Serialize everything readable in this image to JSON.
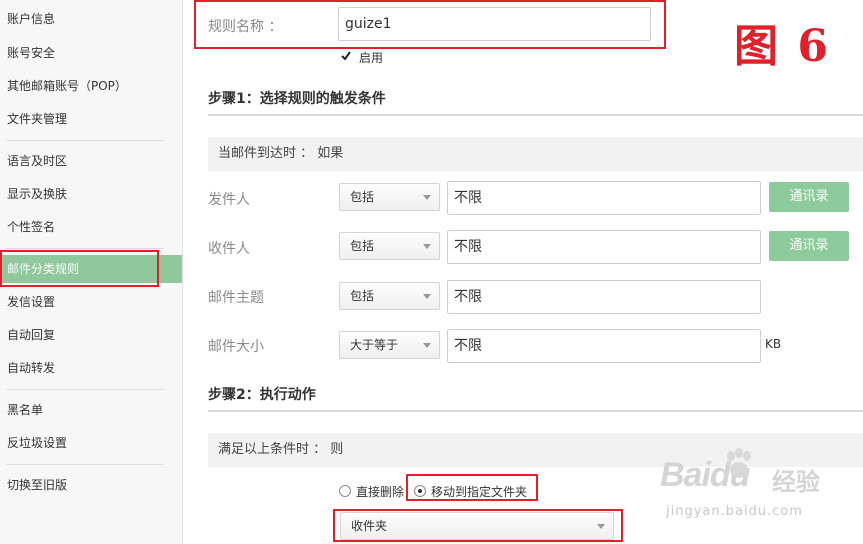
{
  "sidebar": {
    "items": [
      {
        "label": "账户信息"
      },
      {
        "label": "账号安全"
      },
      {
        "label": "其他邮箱账号（POP）"
      },
      {
        "label": "文件夹管理"
      },
      {
        "label": "语言及时区"
      },
      {
        "label": "显示及换肤"
      },
      {
        "label": "个性签名"
      },
      {
        "label": "邮件分类规则"
      },
      {
        "label": "发信设置"
      },
      {
        "label": "自动回复"
      },
      {
        "label": "自动转发"
      },
      {
        "label": "黑名单"
      },
      {
        "label": "反垃圾设置"
      },
      {
        "label": "切换至旧版"
      }
    ],
    "active_item": "邮件分类规则"
  },
  "rule": {
    "name_label": "规则名称 ：",
    "name_value": "guize1",
    "enable_label": "启用",
    "enabled": true
  },
  "figure_label": "图 6",
  "step1": {
    "title": "步骤1：选择规则的触发条件",
    "band": "当邮件到达时 ： 如果",
    "rows": [
      {
        "label": "发件人",
        "op": "包括",
        "value": "不限",
        "button": "通讯录",
        "unit": ""
      },
      {
        "label": "收件人",
        "op": "包括",
        "value": "不限",
        "button": "通讯录",
        "unit": ""
      },
      {
        "label": "邮件主题",
        "op": "包括",
        "value": "不限",
        "button": "",
        "unit": ""
      },
      {
        "label": "邮件大小",
        "op": "大于等于",
        "value": "不限",
        "button": "",
        "unit": "KB"
      }
    ]
  },
  "step2": {
    "title": "步骤2：执行动作",
    "band": "满足以上条件时 ： 则",
    "option_delete": "直接删除",
    "option_move": "移动到指定文件夹",
    "selected_option": "移动到指定文件夹",
    "folder": "收件夹"
  },
  "watermark": {
    "logo": "Baidu",
    "cn": "经验",
    "url": "jingyan.baidu.com"
  },
  "colors": {
    "accent_green": "#8ec89b",
    "highlight_red": "#e0202a"
  }
}
